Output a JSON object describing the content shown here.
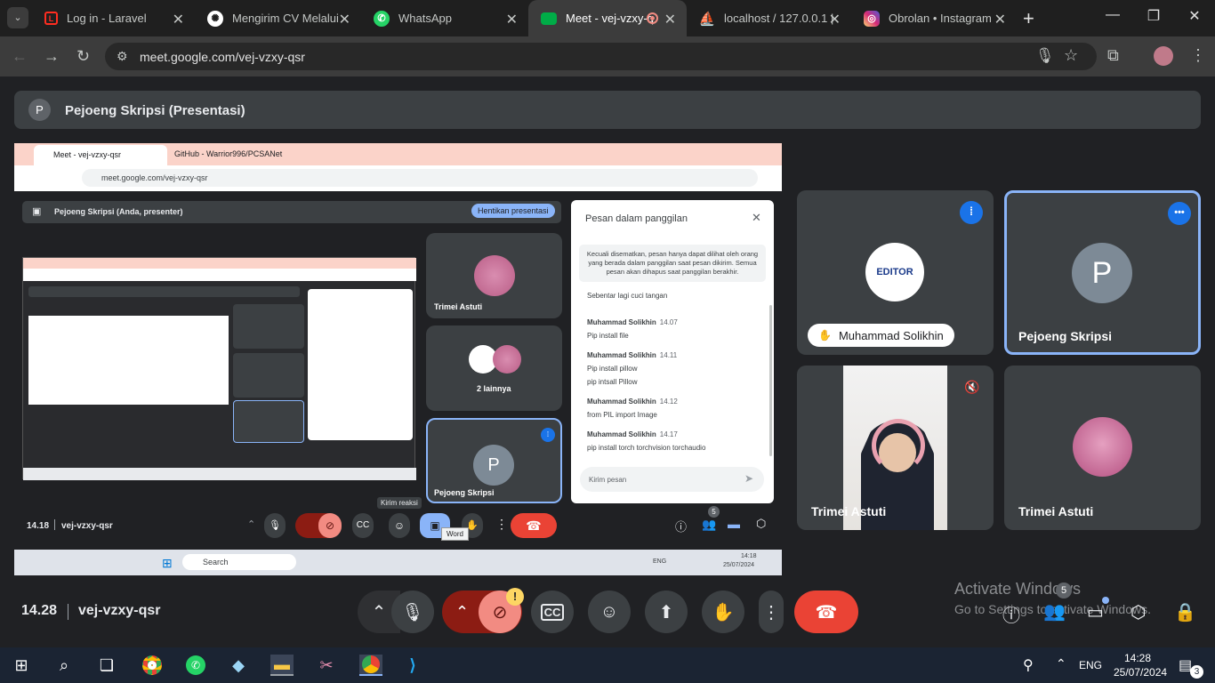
{
  "browser": {
    "tabs": [
      {
        "label": "Log in - Laravel",
        "icon": "laravel-icon",
        "color": "#ff2d20"
      },
      {
        "label": "Mengirim CV Melalui",
        "icon": "chatgpt-icon",
        "color": "#ffffff"
      },
      {
        "label": "WhatsApp",
        "icon": "whatsapp-icon",
        "color": "#25d366"
      },
      {
        "label": "Meet - vej-vzxy-q",
        "icon": "meet-icon",
        "color": "#00ac47"
      },
      {
        "label": "localhost / 127.0.0.1 |",
        "icon": "phpmyadmin-icon",
        "color": "#f29111"
      },
      {
        "label": "Obrolan • Instagram",
        "icon": "instagram-icon",
        "color": "#e1306c"
      }
    ],
    "url": "meet.google.com/vej-vzxy-qsr"
  },
  "meet": {
    "presenter_banner": {
      "avatar": "P",
      "title": "Pejoeng Skripsi (Presentasi)"
    },
    "tiles": [
      {
        "name": "Muhammad Solikhin",
        "avatar": "EDITOR"
      },
      {
        "name": "Pejoeng Skripsi",
        "avatar": "P"
      },
      {
        "name": "Trimei Astuti"
      },
      {
        "name": "Trimei Astuti"
      }
    ],
    "bottom": {
      "time": "14.28",
      "code": "vej-vzxy-qsr",
      "people_count": "5",
      "watermark_title": "Activate Windows",
      "watermark_sub": "Go to Settings to activate Windows.",
      "badge": "!"
    }
  },
  "shared_screen": {
    "tabs": [
      {
        "label": "Meet - vej-vzxy-qsr"
      },
      {
        "label": "GitHub - Warrior996/PCSANet"
      }
    ],
    "url": "meet.google.com/vej-vzxy-qsr",
    "presenting_label": "Pejoeng Skripsi (Anda, presenter)",
    "stop_button": "Hentikan presentasi",
    "side_tiles": [
      {
        "name": "Trimei Astuti"
      },
      {
        "name": "2 lainnya"
      },
      {
        "name": "Pejoeng Skripsi",
        "avatar": "P"
      }
    ],
    "chat": {
      "title": "Pesan dalam panggilan",
      "notice": "Kecuali disematkan, pesan hanya dapat dilihat oleh orang yang berada dalam panggilan saat pesan dikirim. Semua pesan akan dihapus saat panggilan berakhir.",
      "first_line": "Sebentar lagi cuci tangan",
      "messages": [
        {
          "sender": "Muhammad Solikhin",
          "time": "14.07",
          "lines": [
            "Pip install file"
          ]
        },
        {
          "sender": "Muhammad Solikhin",
          "time": "14.11",
          "lines": [
            "Pip install pillow",
            "pip intsall Pillow"
          ]
        },
        {
          "sender": "Muhammad Solikhin",
          "time": "14.12",
          "lines": [
            "from PIL import Image"
          ]
        },
        {
          "sender": "Muhammad Solikhin",
          "time": "14.17",
          "lines": [
            "pip install torch torchvision torchaudio"
          ]
        }
      ],
      "input_placeholder": "Kirim pesan"
    },
    "time": "14.18",
    "code": "vej-vzxy-qsr",
    "tooltip_reaction": "Kirim reaksi",
    "tooltip_word": "Word",
    "people_count": "5",
    "taskbar": {
      "search": "Search",
      "lang": "ENG",
      "time": "14:18",
      "date": "25/07/2024"
    }
  },
  "taskbar": {
    "lang": "ENG",
    "time": "14:28",
    "date": "25/07/2024",
    "notif_count": "3"
  }
}
